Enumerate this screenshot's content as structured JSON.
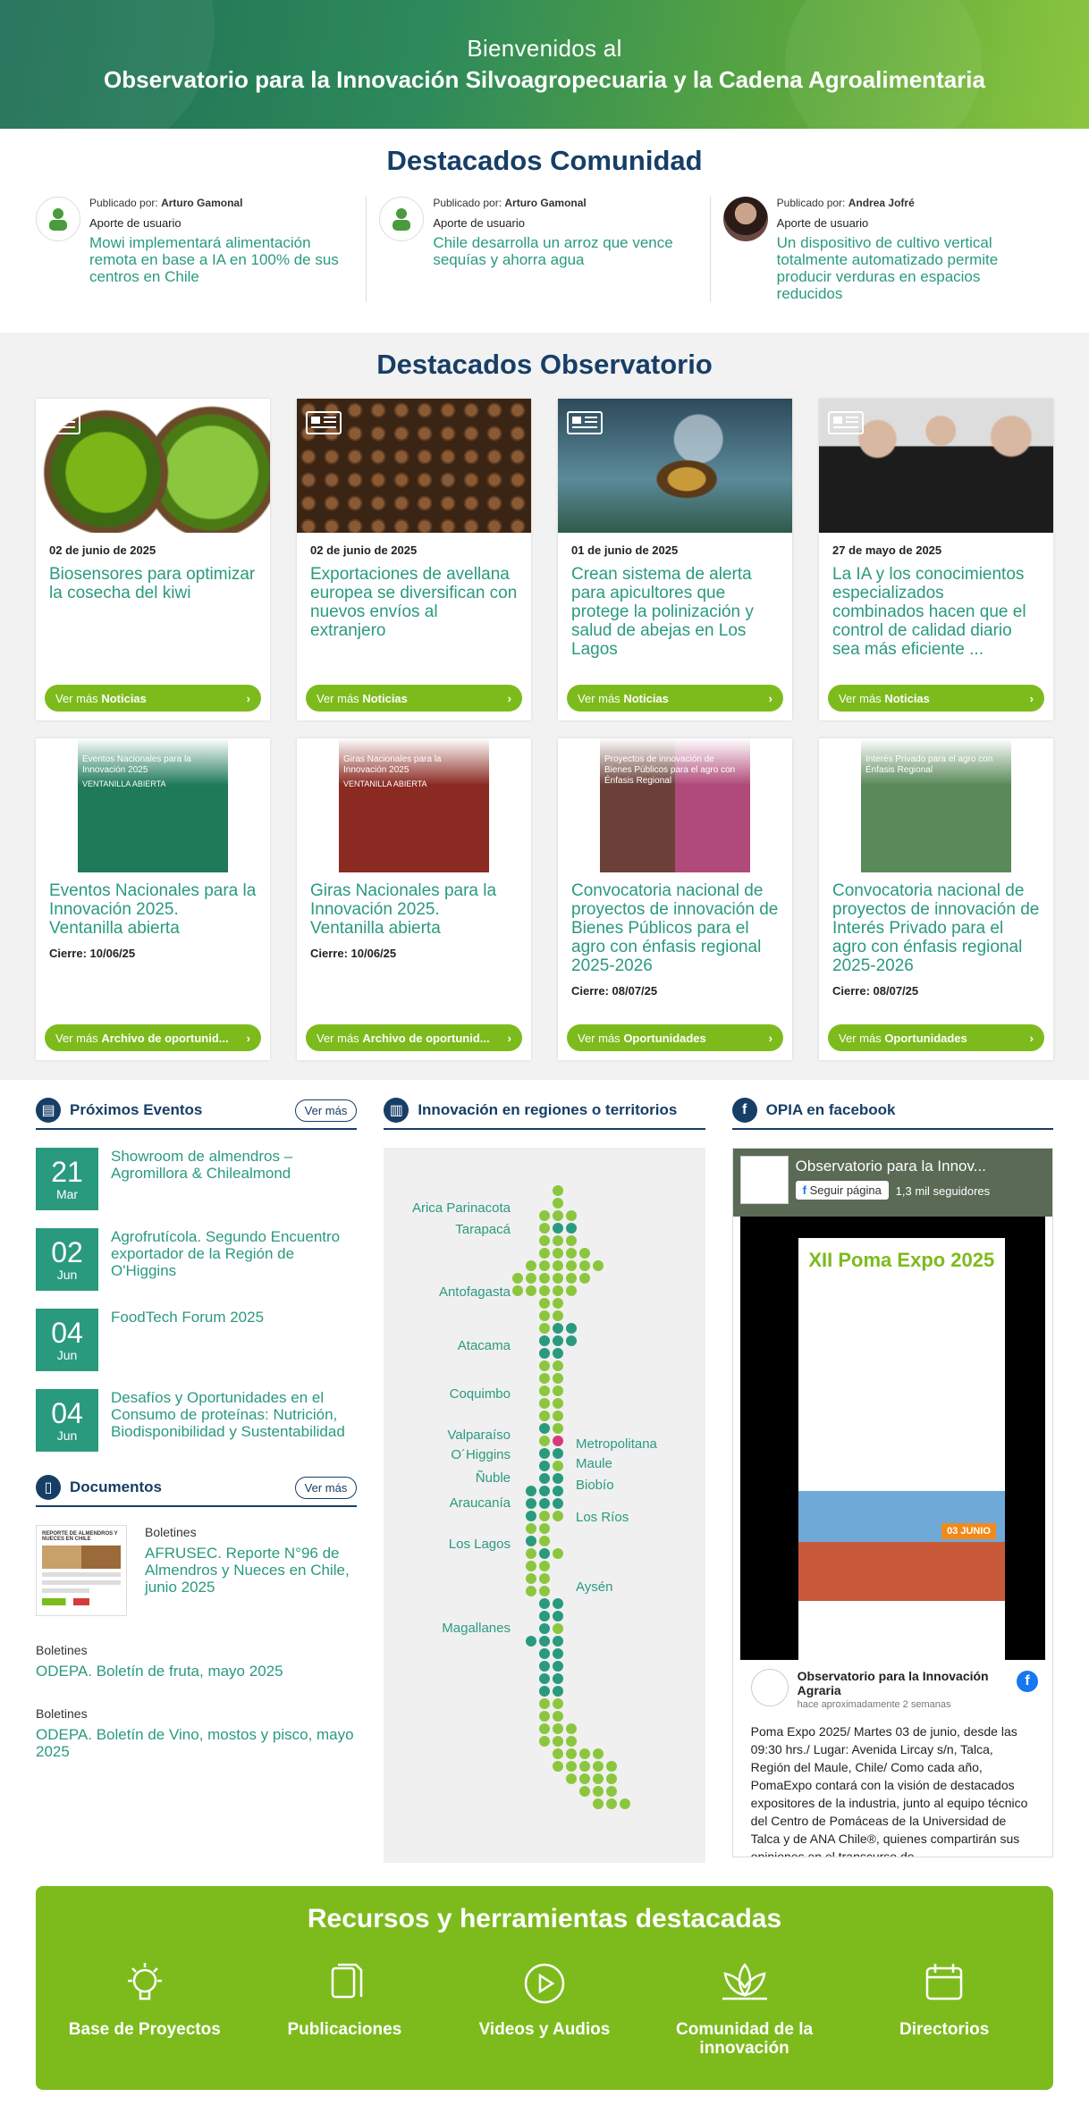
{
  "hero": {
    "line1": "Bienvenidos al",
    "line2": "Observatorio para la Innovación Silvoagropecuaria y la Cadena Agroalimentaria"
  },
  "community": {
    "title": "Destacados Comunidad",
    "items": [
      {
        "by_label": "Publicado por:",
        "author": "Arturo Gamonal",
        "tag": "Aporte de usuario",
        "title": "Mowi implementará alimentación remota en base a IA en 100% de sus centros en Chile"
      },
      {
        "by_label": "Publicado por:",
        "author": "Arturo Gamonal",
        "tag": "Aporte de usuario",
        "title": "Chile desarrolla un arroz que vence sequías y ahorra agua"
      },
      {
        "by_label": "Publicado por:",
        "author": "Andrea Jofré",
        "tag": "Aporte de usuario",
        "title": "Un dispositivo de cultivo vertical totalmente automatizado permite producir verduras en espacios reducidos"
      }
    ]
  },
  "observatory": {
    "title": "Destacados Observatorio",
    "news": [
      {
        "date": "02 de junio de 2025",
        "title": "Biosensores para optimizar la cosecha del kiwi",
        "btn_prefix": "Ver más",
        "btn_bold": "Noticias"
      },
      {
        "date": "02 de junio de 2025",
        "title": "Exportaciones de avellana europea se diversifican con nuevos envíos al extranjero",
        "btn_prefix": "Ver más",
        "btn_bold": "Noticias"
      },
      {
        "date": "01 de junio de 2025",
        "title": "Crean sistema de alerta para apicultores que protege la polinización y salud de abejas en Los Lagos",
        "btn_prefix": "Ver más",
        "btn_bold": "Noticias"
      },
      {
        "date": "27 de mayo de 2025",
        "title": "La IA y los conocimientos especializados combinados hacen que el control de calidad diario sea más eficiente ...",
        "btn_prefix": "Ver más",
        "btn_bold": "Noticias"
      }
    ],
    "opps": [
      {
        "title": "Eventos Nacionales para la Innovación 2025. Ventanilla abierta",
        "close": "Cierre: 10/06/25",
        "btn_prefix": "Ver más",
        "btn_bold": "Archivo de oportunid...",
        "img_text": "Eventos Nacionales para la Innovación 2025",
        "img_sub": "VENTANILLA ABIERTA"
      },
      {
        "title": "Giras Nacionales para la Innovación 2025. Ventanilla abierta",
        "close": "Cierre: 10/06/25",
        "btn_prefix": "Ver más",
        "btn_bold": "Archivo de oportunid...",
        "img_text": "Giras Nacionales para la Innovación 2025",
        "img_sub": "VENTANILLA ABIERTA"
      },
      {
        "title": "Convocatoria nacional de proyectos de innovación de Bienes Públicos para el agro con énfasis regional 2025-2026",
        "close": "Cierre: 08/07/25",
        "btn_prefix": "Ver más",
        "btn_bold": "Oportunidades",
        "img_text": "Proyectos de innovación de Bienes Públicos para el agro con Énfasis Regional",
        "img_sub": ""
      },
      {
        "title": "Convocatoria nacional de proyectos de innovación de Interés Privado para el agro con énfasis regional 2025-2026",
        "close": "Cierre: 08/07/25",
        "btn_prefix": "Ver más",
        "btn_bold": "Oportunidades",
        "img_text": "Interés Privado para el agro con Énfasis Regional",
        "img_sub": ""
      }
    ]
  },
  "events": {
    "title": "Próximos Eventos",
    "more": "Ver más",
    "items": [
      {
        "day": "21",
        "month": "Mar",
        "title": "Showroom de almendros – Agromillora & Chilealmond"
      },
      {
        "day": "02",
        "month": "Jun",
        "title": "Agrofrutícola. Segundo Encuentro exportador de la Región de O'Higgins"
      },
      {
        "day": "04",
        "month": "Jun",
        "title": "FoodTech Forum 2025"
      },
      {
        "day": "04",
        "month": "Jun",
        "title": "Desafíos y Oportunidades en el Consumo de proteínas: Nutrición, Biodisponibilidad y Sustentabilidad"
      }
    ]
  },
  "documents": {
    "title": "Documentos",
    "more": "Ver más",
    "items": [
      {
        "kind": "Boletines",
        "title": "AFRUSEC. Reporte N°96 de Almendros y Nueces en Chile, junio 2025"
      },
      {
        "kind": "Boletines",
        "title": "ODEPA. Boletín de fruta, mayo 2025"
      },
      {
        "kind": "Boletines",
        "title": "ODEPA. Boletín de Vino, mostos y pisco, mayo 2025"
      }
    ],
    "thumb_title": "REPORTE DE ALMENDROS Y NUECES EN CHILE"
  },
  "regions": {
    "title": "Innovación en regiones o territorios",
    "left": [
      "Arica Parinacota",
      "Tarapacá",
      "Antofagasta",
      "Atacama",
      "Coquimbo",
      "Valparaíso",
      "O´Higgins",
      "Ñuble",
      "Araucanía",
      "Los Lagos",
      "Magallanes"
    ],
    "right": [
      "Metropolitana",
      "Maule",
      "Biobío",
      "Los Ríos",
      "Aysén"
    ]
  },
  "facebook": {
    "title": "OPIA en facebook",
    "page_name": "Observatorio para la Innov...",
    "follow": "Seguir página",
    "followers": "1,3 mil seguidores",
    "post_name": "Observatorio para la Innovación Agraria",
    "post_date": "hace aproximadamente 2 semanas",
    "post_text": "Poma Expo 2025/ Martes 03 de junio, desde las 09:30 hrs./ Lugar: Avenida Lircay s/n, Talca, Región del Maule, Chile/ Como cada año, PomaExpo contará con la visión de destacados expositores de la industria, junto al equipo técnico del Centro de Pomáceas de la Universidad de Talca y de ANA Chile®, quienes compartirán sus opiniones en el transcurso de",
    "poster_title": "XII Poma Expo 2025",
    "poster_date": "03 JUNIO"
  },
  "resources": {
    "title": "Recursos y herramientas destacadas",
    "items": [
      {
        "label": "Base de Proyectos",
        "icon": "lightbulb-icon"
      },
      {
        "label": "Publicaciones",
        "icon": "documents-icon"
      },
      {
        "label": "Videos y Audios",
        "icon": "play-icon"
      },
      {
        "label": "Comunidad de la innovación",
        "icon": "lotus-icon"
      },
      {
        "label": "Directorios",
        "icon": "calendar-icon"
      }
    ]
  },
  "colors": {
    "teal": "#2a9a7e",
    "navy": "#173e66",
    "green": "#7dbb1d",
    "magenta": "#d63a7b"
  }
}
